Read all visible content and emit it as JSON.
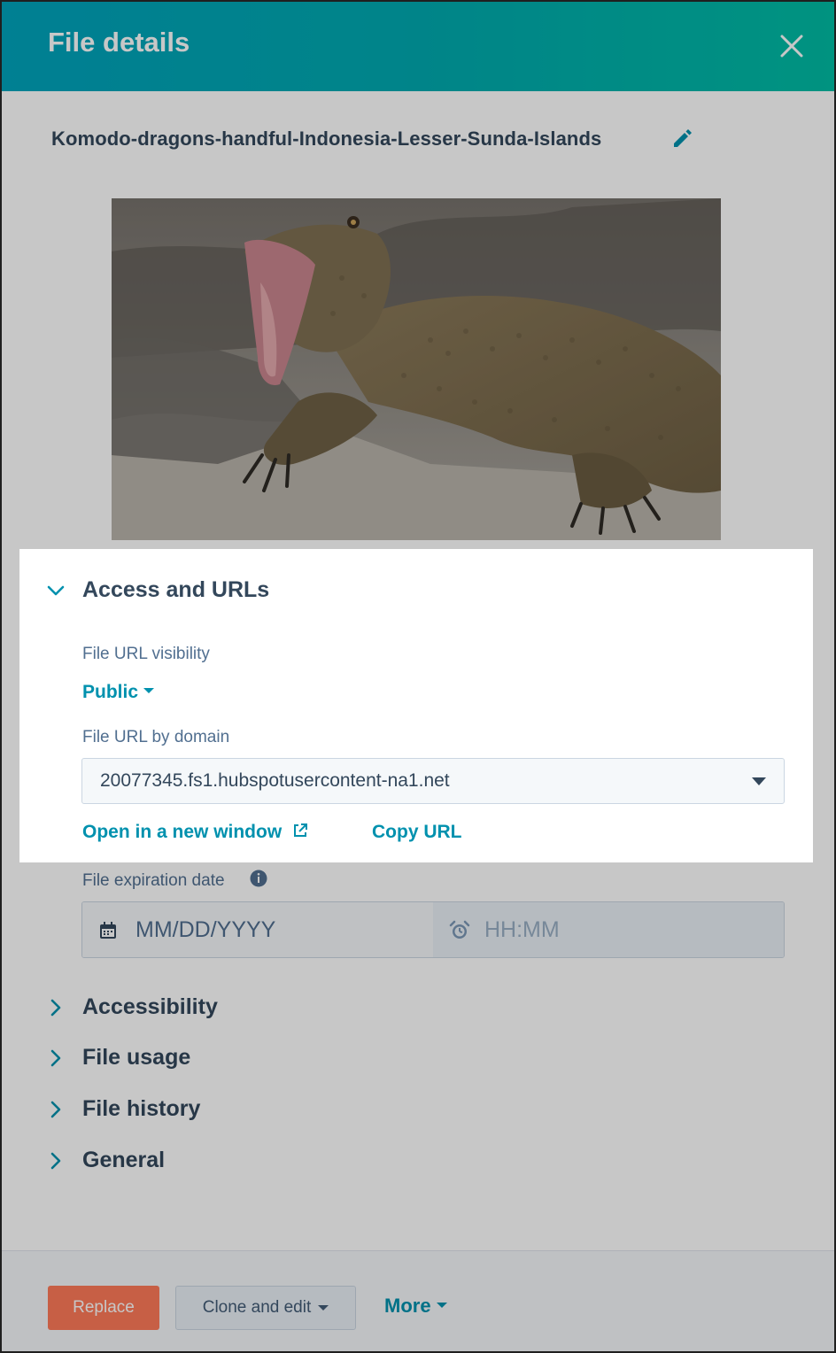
{
  "header": {
    "title": "File details"
  },
  "file": {
    "name": "Komodo-dragons-handful-Indonesia-Lesser-Sunda-Islands"
  },
  "sections": {
    "access": {
      "label": "Access and URLs",
      "visibility_label": "File URL visibility",
      "visibility_value": "Public",
      "domain_label": "File URL by domain",
      "domain_value": "20077345.fs1.hubspotusercontent-na1.net",
      "open_link": "Open in a new window",
      "copy_link": "Copy URL",
      "expiration_label": "File expiration date",
      "date_placeholder": "MM/DD/YYYY",
      "time_placeholder": "HH:MM"
    },
    "accessibility": {
      "label": "Accessibility"
    },
    "usage": {
      "label": "File usage"
    },
    "history": {
      "label": "File history"
    },
    "general": {
      "label": "General"
    }
  },
  "footer": {
    "replace_label": "Replace",
    "clone_label": "Clone and edit",
    "more_label": "More"
  },
  "colors": {
    "header_start": "#00a4bd",
    "header_end": "#00bda5",
    "link": "#0091ae",
    "replace": "#ff7a59",
    "text": "#33475b"
  },
  "icons": {
    "close": "close-icon",
    "edit": "pencil-icon",
    "calendar": "calendar-icon",
    "clock": "alarm-clock-icon",
    "info": "info-icon",
    "external": "external-link-icon"
  }
}
